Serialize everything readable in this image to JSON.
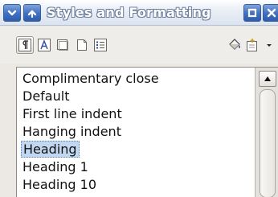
{
  "window": {
    "title": "Styles and Formatting",
    "title_buttons": [
      {
        "name": "menu-button",
        "icon": "chevron-down-icon"
      },
      {
        "name": "roll-up-button",
        "icon": "chevron-up-icon"
      },
      {
        "name": "maximize-button",
        "icon": "square-icon"
      },
      {
        "name": "close-button",
        "icon": "close-icon"
      }
    ]
  },
  "toolbar": {
    "items": [
      {
        "name": "paragraph-styles-button",
        "icon": "paragraph-styles-icon",
        "active": true
      },
      {
        "name": "character-styles-button",
        "icon": "character-styles-icon"
      },
      {
        "name": "frame-styles-button",
        "icon": "frame-styles-icon"
      },
      {
        "name": "page-styles-button",
        "icon": "page-styles-icon"
      },
      {
        "name": "list-styles-button",
        "icon": "list-styles-icon"
      },
      {
        "name": "fill-format-button",
        "icon": "paint-bucket-icon"
      },
      {
        "name": "new-style-button",
        "icon": "new-style-icon"
      },
      {
        "name": "style-options-dropdown",
        "icon": "dropdown-arrow-icon"
      }
    ]
  },
  "styles_list": {
    "items": [
      "Complimentary close",
      "Default",
      "First line indent",
      "Hanging indent",
      "Heading",
      "Heading 1",
      "Heading 10"
    ],
    "selected": "Heading"
  },
  "colors": {
    "titlebar_button": "#3e6fc2",
    "selection": "#c2d8f0"
  }
}
